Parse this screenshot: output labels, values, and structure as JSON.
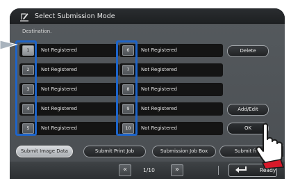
{
  "title": "Select Submission Mode",
  "destination_label": "Destination.",
  "left_column": [
    {
      "num": "1",
      "label": "Not Registered",
      "selected": true
    },
    {
      "num": "2",
      "label": "Not Registered",
      "selected": false
    },
    {
      "num": "3",
      "label": "Not Registered",
      "selected": false
    },
    {
      "num": "4",
      "label": "Not Registered",
      "selected": false
    },
    {
      "num": "5",
      "label": "Not Registered",
      "selected": false
    }
  ],
  "right_column": [
    {
      "num": "6",
      "label": "Not Registered"
    },
    {
      "num": "7",
      "label": "Not Registered"
    },
    {
      "num": "8",
      "label": "Not Registered"
    },
    {
      "num": "9",
      "label": "Not Registered"
    },
    {
      "num": "10",
      "label": "Not Registered"
    }
  ],
  "buttons": {
    "delete": "Delete",
    "add_edit": "Add/Edit",
    "ok": "OK"
  },
  "tabs": [
    {
      "label": "Submit Image Data",
      "active": true
    },
    {
      "label": "Submit Print Job",
      "active": false
    },
    {
      "label": "Submission Job Box",
      "active": false
    },
    {
      "label": "Submit from T",
      "active": false
    }
  ],
  "pager": {
    "prev": "«",
    "page": "1/10",
    "next": "»"
  },
  "ready": "Ready",
  "colors": {
    "highlight": "#1e64c8",
    "callout": "#a9b3bd",
    "tab_active": "#c8cbce"
  }
}
